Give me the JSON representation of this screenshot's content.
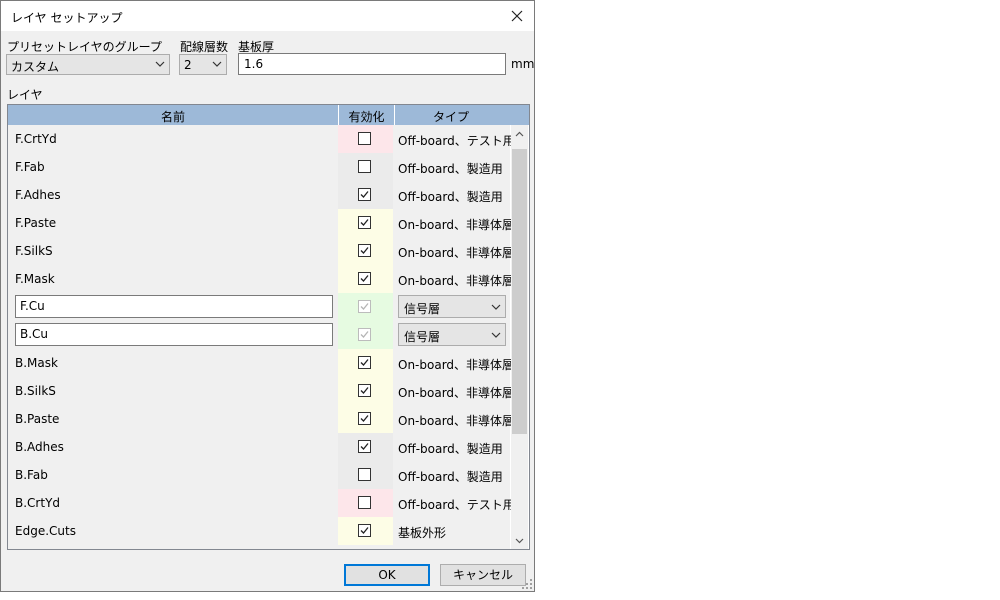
{
  "window": {
    "title": "レイヤ セットアップ"
  },
  "preset": {
    "label": "プリセットレイヤのグループ",
    "value": "カスタム"
  },
  "copper": {
    "label": "配線層数",
    "value": "2"
  },
  "thickness": {
    "label": "基板厚",
    "value": "1.6",
    "unit": "mm"
  },
  "layers_label": "レイヤ",
  "grid": {
    "headers": {
      "name": "名前",
      "enabled": "有効化",
      "type": "タイプ"
    },
    "rows": [
      {
        "name": "F.CrtYd",
        "checked": false,
        "type": "Off-board、テスト用",
        "color": "#fde6ea"
      },
      {
        "name": "F.Fab",
        "checked": false,
        "type": "Off-board、製造用",
        "color": "#ebebeb"
      },
      {
        "name": "F.Adhes",
        "checked": true,
        "type": "Off-board、製造用",
        "color": "#ebebeb"
      },
      {
        "name": "F.Paste",
        "checked": true,
        "type": "On-board、非導体層",
        "color": "#fdfde6"
      },
      {
        "name": "F.SilkS",
        "checked": true,
        "type": "On-board、非導体層",
        "color": "#fdfde6"
      },
      {
        "name": "F.Mask",
        "checked": true,
        "type": "On-board、非導体層",
        "color": "#fdfde6"
      },
      {
        "name": "F.Cu",
        "checked": true,
        "type": "信号層",
        "color": "#e6fbe1",
        "editable": true
      },
      {
        "name": "B.Cu",
        "checked": true,
        "type": "信号層",
        "color": "#e6fbe1",
        "editable": true
      },
      {
        "name": "B.Mask",
        "checked": true,
        "type": "On-board、非導体層",
        "color": "#fdfde6"
      },
      {
        "name": "B.SilkS",
        "checked": true,
        "type": "On-board、非導体層",
        "color": "#fdfde6"
      },
      {
        "name": "B.Paste",
        "checked": true,
        "type": "On-board、非導体層",
        "color": "#fdfde6"
      },
      {
        "name": "B.Adhes",
        "checked": true,
        "type": "Off-board、製造用",
        "color": "#ebebeb"
      },
      {
        "name": "B.Fab",
        "checked": false,
        "type": "Off-board、製造用",
        "color": "#ebebeb"
      },
      {
        "name": "B.CrtYd",
        "checked": false,
        "type": "Off-board、テスト用",
        "color": "#fde6ea"
      },
      {
        "name": "Edge.Cuts",
        "checked": true,
        "type": "基板外形",
        "color": "#fdfde6"
      }
    ]
  },
  "buttons": {
    "ok": "OK",
    "cancel": "キャンセル"
  }
}
